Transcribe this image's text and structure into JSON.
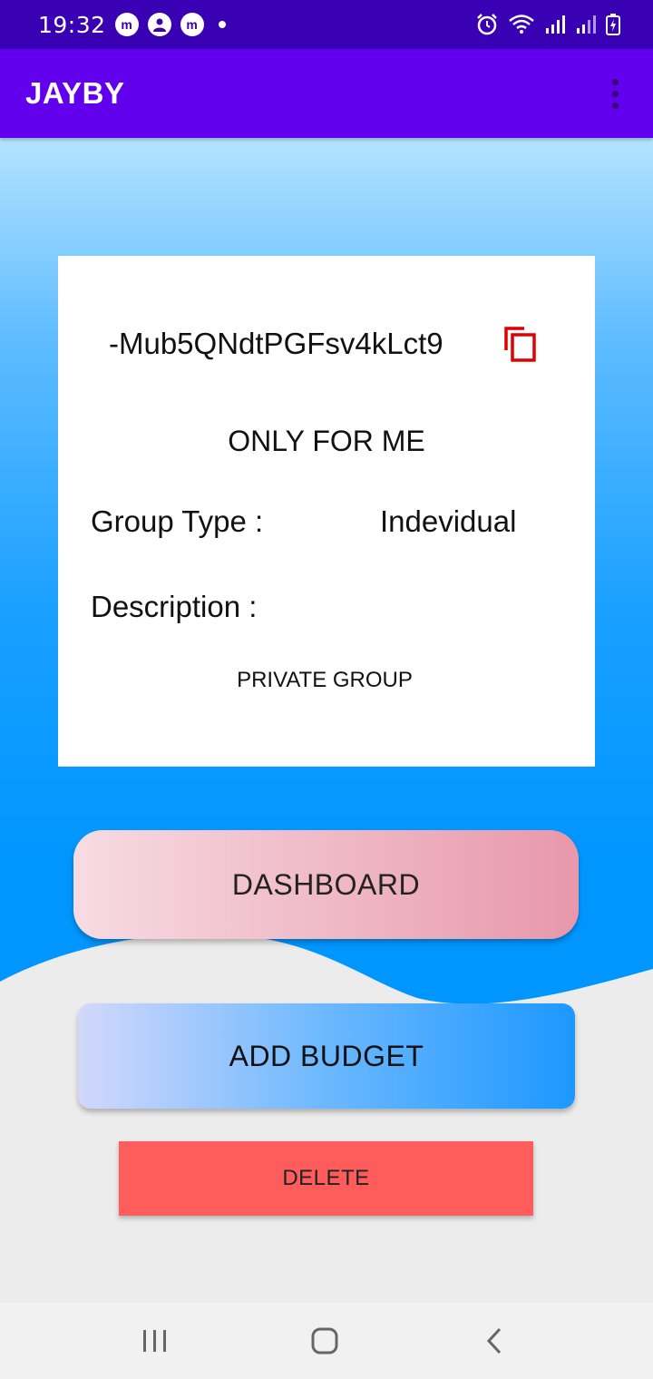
{
  "status_bar": {
    "time": "19:32",
    "notification_icons": [
      "messenger-icon",
      "account-icon",
      "messenger-icon"
    ],
    "system_icons": [
      "alarm-icon",
      "wifi-icon",
      "signal-icon",
      "signal-icon",
      "battery-icon"
    ]
  },
  "app_bar": {
    "title": "JAYBY",
    "menu_icon": "more-vert-icon"
  },
  "group_card": {
    "group_id": "-Mub5QNdtPGFsv4kLct9",
    "copy_icon": "copy-icon",
    "group_name": "ONLY FOR ME",
    "type_label": "Group Type :",
    "type_value": "Indevidual",
    "description_label": "Description :",
    "description_value": "PRIVATE GROUP"
  },
  "actions": {
    "dashboard_label": "DASHBOARD",
    "add_budget_label": "ADD BUDGET",
    "delete_label": "DELETE"
  },
  "nav_bar": {
    "items": [
      "recent-apps-icon",
      "home-icon",
      "back-icon"
    ]
  },
  "colors": {
    "status_bar": "#3a00b4",
    "app_bar": "#6200ee",
    "background_blue": "#0096ff",
    "delete_red": "#ff5c5c",
    "copy_icon_red": "#e00000"
  }
}
